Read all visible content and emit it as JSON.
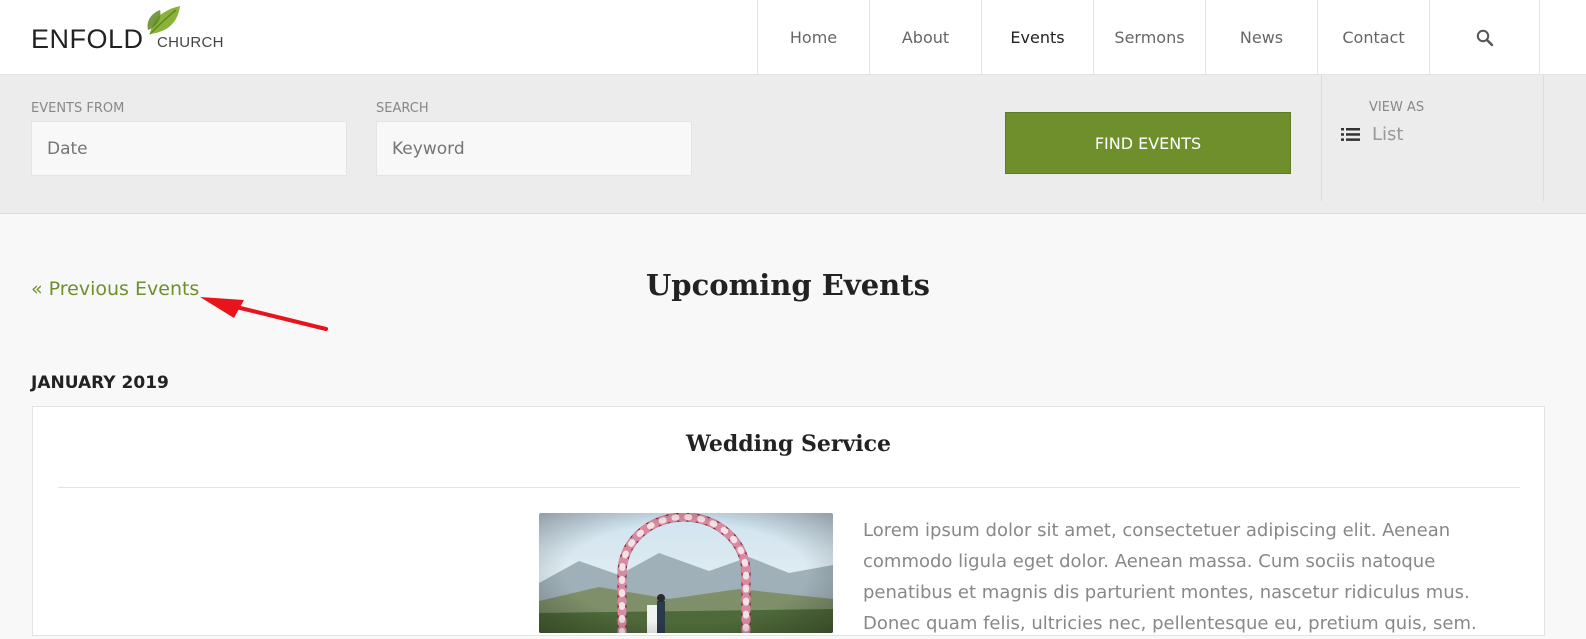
{
  "header": {
    "logo": {
      "primary": "ENFOLD",
      "secondary": "CHURCH"
    },
    "nav": [
      {
        "label": "Home"
      },
      {
        "label": "About"
      },
      {
        "label": "Events"
      },
      {
        "label": "Sermons"
      },
      {
        "label": "News"
      },
      {
        "label": "Contact"
      }
    ],
    "active_nav": "Events",
    "search_icon": "search-icon"
  },
  "filters": {
    "events_from_label": "EVENTS FROM",
    "events_from_placeholder": "Date",
    "search_label": "SEARCH",
    "search_placeholder": "Keyword",
    "find_button": "FIND EVENTS",
    "view_as_label": "VIEW AS",
    "view_as_value": "List",
    "view_as_icon": "list-icon"
  },
  "content": {
    "previous_link": "« Previous Events",
    "page_title": "Upcoming Events",
    "month_heading": "JANUARY 2019",
    "event": {
      "title": "Wedding Service",
      "description": "Lorem ipsum dolor sit amet, consectetuer adipiscing elit. Aenean commodo ligula eget dolor. Aenean massa. Cum sociis natoque penatibus et magnis dis parturient montes, nascetur ridiculus mus. Donec quam felis, ultricies nec, pellentesque eu, pretium quis, sem."
    }
  },
  "colors": {
    "accent_green": "#6f8f2d",
    "annotation_arrow": "#e8141b"
  }
}
